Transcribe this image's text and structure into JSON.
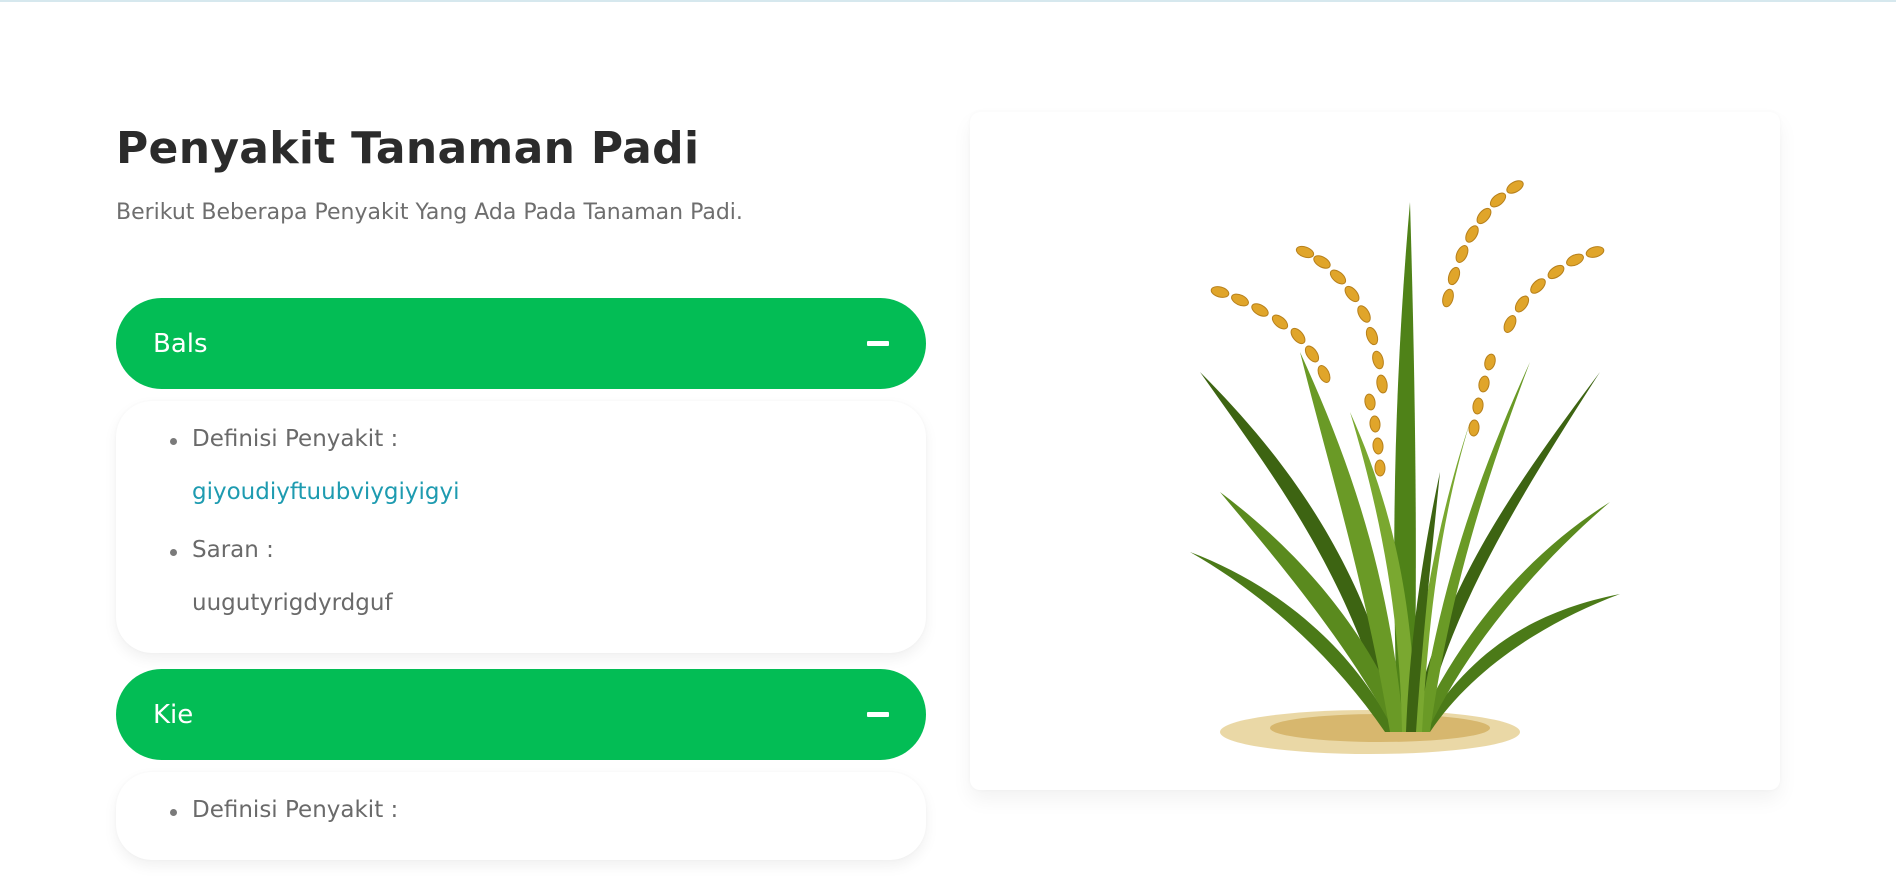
{
  "page": {
    "title": "Penyakit Tanaman Padi",
    "subtitle": "Berikut Beberapa Penyakit Yang Ada Pada Tanaman Padi."
  },
  "diseases": [
    {
      "name": "Bals",
      "expanded": true,
      "definition_label": "Definisi Penyakit :",
      "definition_value": "giyoudiyftuubviygiyigyi",
      "advice_label": "Saran :",
      "advice_value": "uugutyrigdyrdguf"
    },
    {
      "name": "Kie",
      "expanded": true,
      "definition_label": "Definisi Penyakit :"
    }
  ],
  "illustration": {
    "icon": "rice-plant-illustration",
    "colors": {
      "leaf": "#5a8a1e",
      "leaf_dark": "#3d6412",
      "grain": "#e0a52a",
      "soil": "#d9b85c"
    }
  },
  "colors": {
    "accent": "#03bd55",
    "title": "#2b2b2b",
    "muted": "#6e6e6e",
    "link": "#1e9bb0"
  }
}
